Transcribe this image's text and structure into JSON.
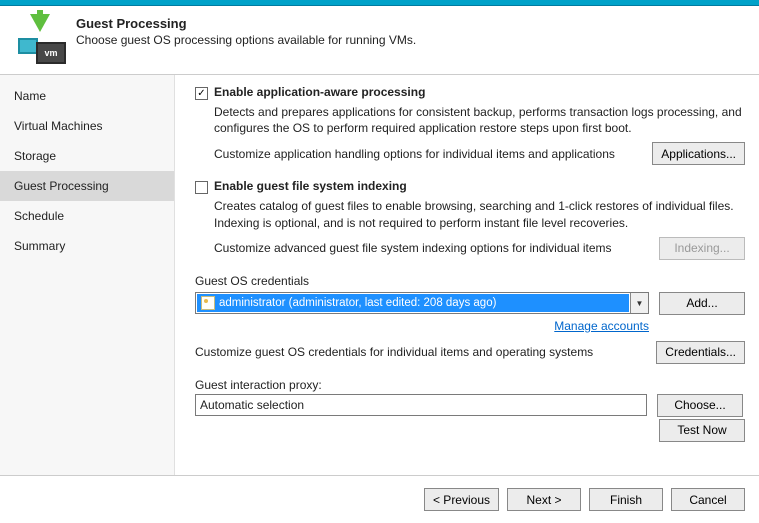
{
  "header": {
    "title": "Guest Processing",
    "subtitle": "Choose guest OS processing options available for running VMs."
  },
  "nav": {
    "items": [
      {
        "label": "Name"
      },
      {
        "label": "Virtual Machines"
      },
      {
        "label": "Storage"
      },
      {
        "label": "Guest Processing"
      },
      {
        "label": "Schedule"
      },
      {
        "label": "Summary"
      }
    ],
    "selected_index": 3
  },
  "section_app": {
    "title": "Enable application-aware processing",
    "desc": "Detects and prepares applications for consistent backup, performs transaction logs processing, and configures the OS to perform required application restore steps upon first boot.",
    "customize_text": "Customize application handling options for individual items and applications",
    "button": "Applications..."
  },
  "section_index": {
    "title": "Enable guest file system indexing",
    "desc": "Creates catalog of guest files to enable browsing, searching and 1-click restores of individual files. Indexing is optional, and is not required to perform instant file level recoveries.",
    "customize_text": "Customize advanced guest file system indexing options for individual items",
    "button": "Indexing..."
  },
  "credentials": {
    "label": "Guest OS credentials",
    "selected": "administrator (administrator, last edited: 208 days ago)",
    "add_button": "Add...",
    "manage_link": "Manage accounts",
    "customize_text": "Customize guest OS credentials for individual items and operating systems",
    "customize_button": "Credentials..."
  },
  "proxy": {
    "label": "Guest interaction proxy:",
    "value": "Automatic selection",
    "choose_button": "Choose...",
    "test_button": "Test Now"
  },
  "footer": {
    "previous": "< Previous",
    "next": "Next >",
    "finish": "Finish",
    "cancel": "Cancel"
  }
}
